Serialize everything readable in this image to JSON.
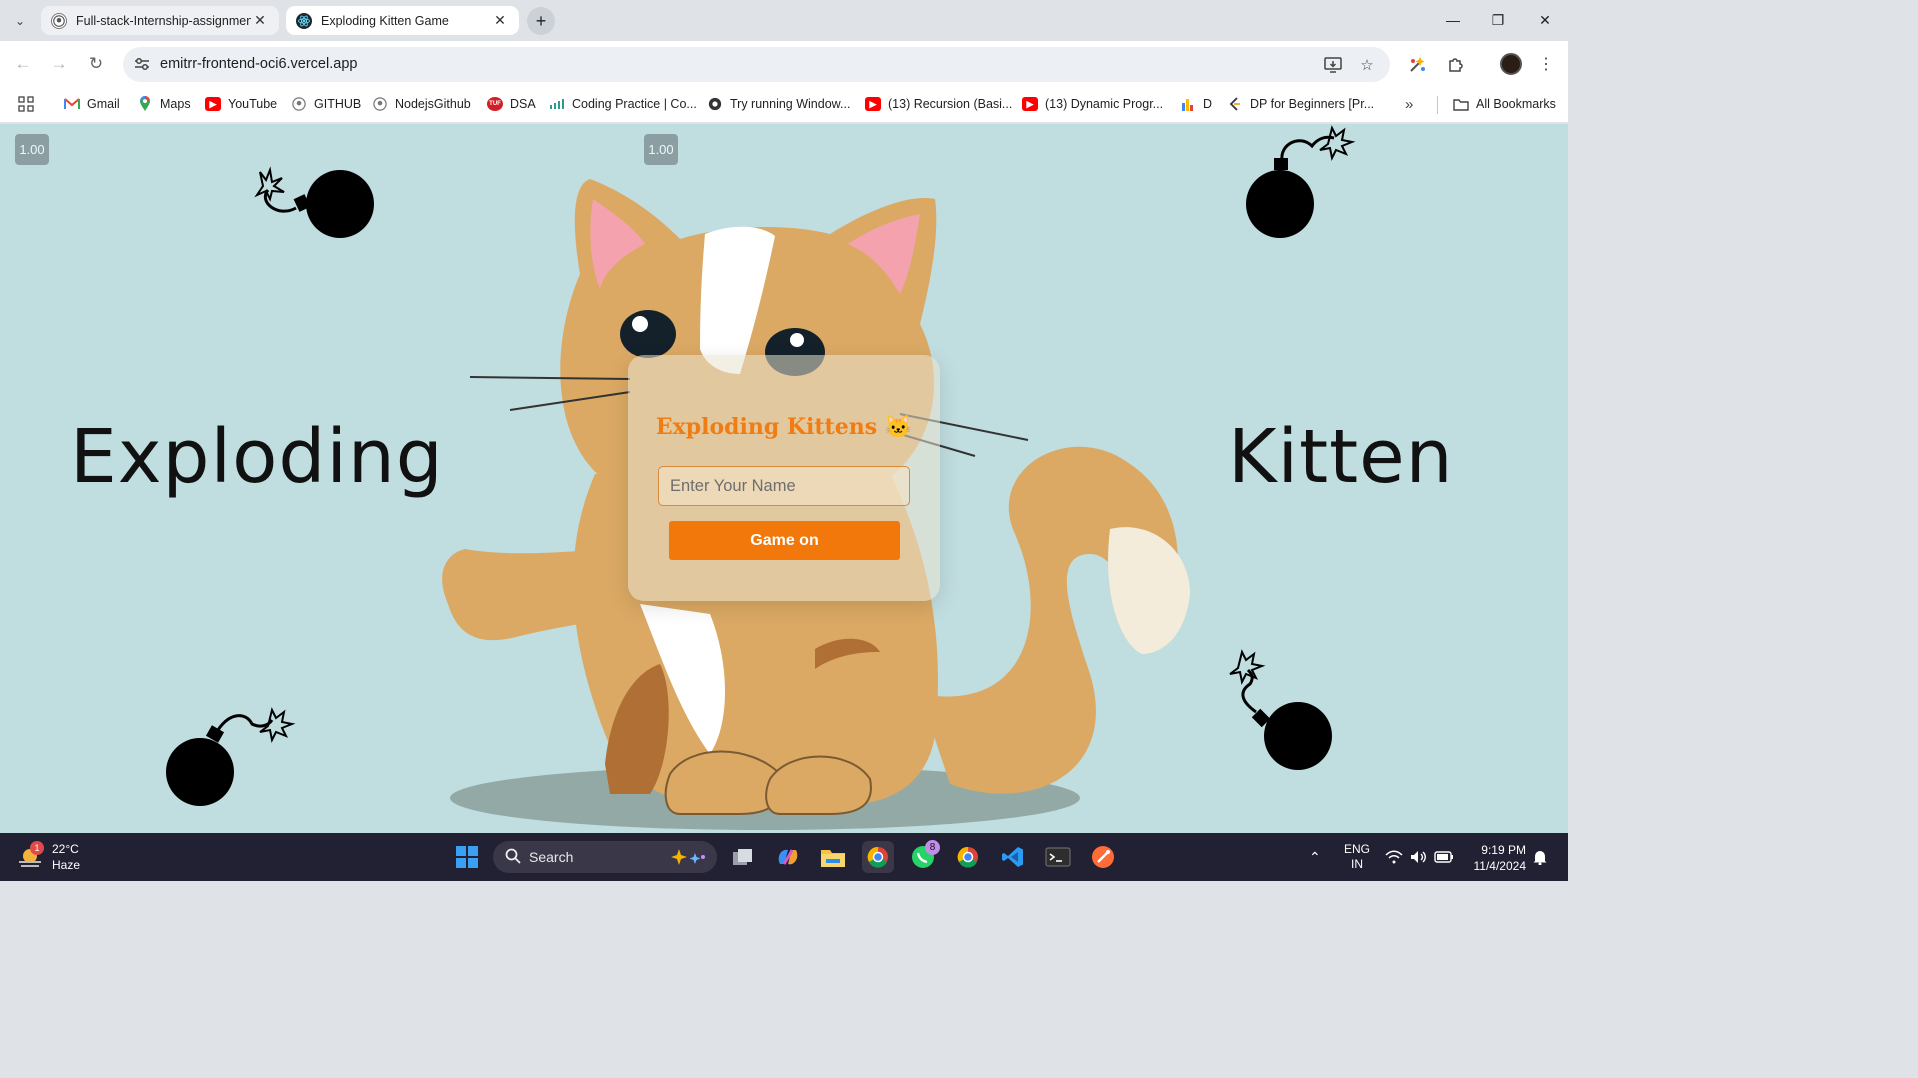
{
  "browser": {
    "tabs": [
      {
        "title": "Full-stack-Internship-assignmen",
        "icon": "github-icon"
      },
      {
        "title": "Exploding Kitten Game",
        "icon": "react-icon"
      }
    ],
    "address": "emitrr-frontend-oci6.vercel.app",
    "bookmarks": [
      {
        "label": "Gmail",
        "icon": "gmail-icon"
      },
      {
        "label": "Maps",
        "icon": "maps-icon"
      },
      {
        "label": "YouTube",
        "icon": "youtube-icon"
      },
      {
        "label": "GITHUB",
        "icon": "github-icon"
      },
      {
        "label": "NodejsGithub",
        "icon": "github-icon"
      },
      {
        "label": "DSA",
        "icon": "tuf-icon"
      },
      {
        "label": "Coding Practice | Co...",
        "icon": "coding-icon"
      },
      {
        "label": "Try running Window...",
        "icon": "globe-icon"
      },
      {
        "label": "(13) Recursion (Basi...",
        "icon": "youtube-icon"
      },
      {
        "label": "(13) Dynamic Progr...",
        "icon": "youtube-icon"
      },
      {
        "label": "D",
        "icon": "chart-icon"
      },
      {
        "label": "DP for Beginners [Pr...",
        "icon": "leetcode-icon"
      }
    ],
    "all_bookmarks": "All Bookmarks"
  },
  "page": {
    "zoom_left": "1.00",
    "zoom_right": "1.00",
    "word_left": "Exploding",
    "word_right": "Kitten",
    "card": {
      "title": "Exploding Kittens 🐱",
      "input_placeholder": "Enter Your Name",
      "input_value": "",
      "button": "Game on"
    }
  },
  "taskbar": {
    "weather_temp": "22°C",
    "weather_desc": "Haze",
    "weather_badge": "1",
    "search": "Search",
    "whatsapp_badge": "8",
    "lang_1": "ENG",
    "lang_2": "IN",
    "time": "9:19 PM",
    "date": "11/4/2024"
  },
  "colors": {
    "page_bg": "#c0dde0",
    "accent": "#f2780c",
    "cat_fur": "#dba964",
    "taskbar": "#222033"
  }
}
